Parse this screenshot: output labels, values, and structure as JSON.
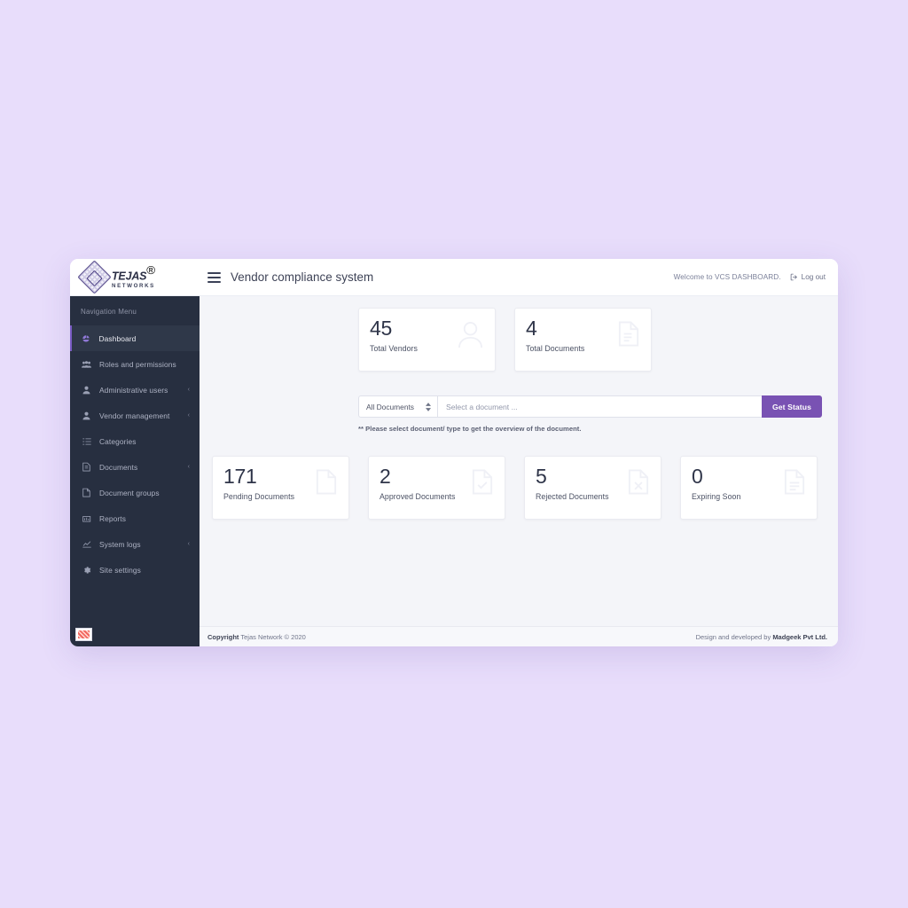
{
  "brand": {
    "name": "TEJAS",
    "sub": "NETWORKS",
    "registered": "®"
  },
  "header": {
    "menu_icon": "hamburger-icon",
    "title": "Vendor compliance system",
    "welcome": "Welcome to VCS DASHBOARD.",
    "logout_label": "Log out",
    "logout_icon": "logout-icon"
  },
  "sidebar": {
    "heading": "Navigation Menu",
    "items": [
      {
        "label": "Dashboard",
        "icon": "dashboard-icon",
        "active": true,
        "caret": ""
      },
      {
        "label": "Roles and permissions",
        "icon": "users-group-icon",
        "active": false,
        "caret": ""
      },
      {
        "label": "Administrative users",
        "icon": "user-icon",
        "active": false,
        "caret": "‹"
      },
      {
        "label": "Vendor management",
        "icon": "user-icon",
        "active": false,
        "caret": "‹"
      },
      {
        "label": "Categories",
        "icon": "list-icon",
        "active": false,
        "caret": ""
      },
      {
        "label": "Documents",
        "icon": "document-icon",
        "active": false,
        "caret": "‹"
      },
      {
        "label": "Document groups",
        "icon": "file-icon",
        "active": false,
        "caret": ""
      },
      {
        "label": "Reports",
        "icon": "chart-bar-icon",
        "active": false,
        "caret": ""
      },
      {
        "label": "System logs",
        "icon": "chart-line-icon",
        "active": false,
        "caret": "‹"
      },
      {
        "label": "Site settings",
        "icon": "gear-icon",
        "active": false,
        "caret": ""
      }
    ],
    "badge_icon": "flag-icon"
  },
  "stats_top": [
    {
      "value": "45",
      "label": "Total Vendors",
      "icon": "user-avatar-icon"
    },
    {
      "value": "4",
      "label": "Total Documents",
      "icon": "document-lines-icon"
    }
  ],
  "stats_bottom": [
    {
      "value": "171",
      "label": "Pending Documents",
      "icon": "file-blank-icon"
    },
    {
      "value": "2",
      "label": "Approved Documents",
      "icon": "file-check-icon"
    },
    {
      "value": "5",
      "label": "Rejected Documents",
      "icon": "file-x-icon"
    },
    {
      "value": "0",
      "label": "Expiring Soon",
      "icon": "file-lines-icon"
    }
  ],
  "filter": {
    "select_value": "All Documents",
    "input_placeholder": "Select a document ...",
    "input_value": "",
    "button_label": "Get Status",
    "note": "** Please select document/ type to get the overview of the document."
  },
  "footer": {
    "copyright_bold": "Copyright",
    "copyright_rest": " Tejas Network © 2020",
    "credit_rest": "Design and developed by ",
    "credit_bold": "Madgeek Pvt Ltd."
  },
  "colors": {
    "page_background": "#e8ddfb",
    "sidebar": "#272f40",
    "sidebar_active": "#2f3849",
    "accent_purple": "#7952b3",
    "content_background": "#f4f5f9",
    "card_background": "#ffffff"
  }
}
